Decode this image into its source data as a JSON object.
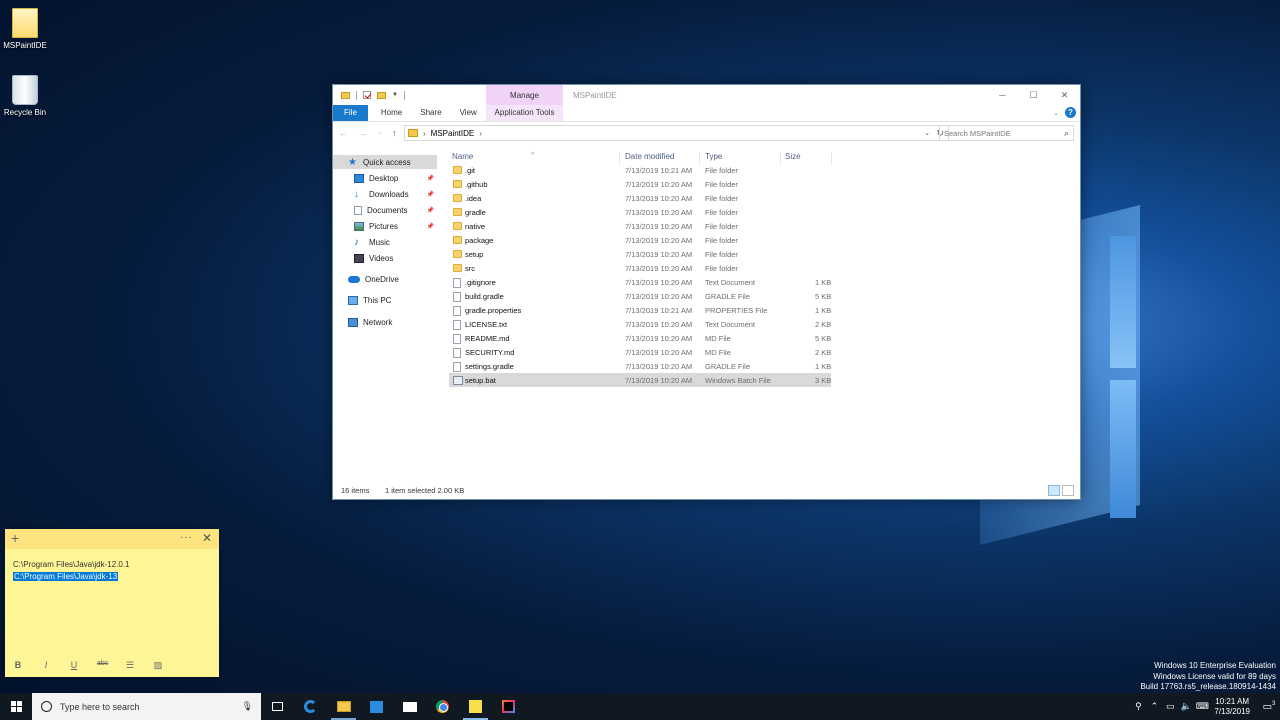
{
  "desktop": {
    "icons": [
      {
        "label": "MSPaintIDE",
        "icon": "folder-icon"
      },
      {
        "label": "Recycle Bin",
        "icon": "recycle-bin-icon"
      }
    ],
    "watermark": [
      "Windows 10 Enterprise Evaluation",
      "Windows License valid for 89 days",
      "Build 17763.rs5_release.180914-1434"
    ]
  },
  "explorer": {
    "title": "MSPaintIDE",
    "manage_tab": "Manage",
    "ribbon_tabs": {
      "file": "File",
      "home": "Home",
      "share": "Share",
      "view": "View",
      "app_tools": "Application Tools"
    },
    "address": {
      "path": "MSPaintIDE",
      "search_placeholder": "Search MSPaintIDE"
    },
    "nav_pane": {
      "quick_access": "Quick access",
      "items": [
        "Desktop",
        "Downloads",
        "Documents",
        "Pictures",
        "Music",
        "Videos"
      ],
      "onedrive": "OneDrive",
      "this_pc": "This PC",
      "network": "Network"
    },
    "columns": {
      "name": "Name",
      "date": "Date modified",
      "type": "Type",
      "size": "Size"
    },
    "files": [
      {
        "name": ".git",
        "date": "7/13/2019 10:21 AM",
        "type": "File folder",
        "size": "",
        "kind": "folder"
      },
      {
        "name": ".github",
        "date": "7/13/2019 10:20 AM",
        "type": "File folder",
        "size": "",
        "kind": "folder"
      },
      {
        "name": ".idea",
        "date": "7/13/2019 10:20 AM",
        "type": "File folder",
        "size": "",
        "kind": "folder"
      },
      {
        "name": "gradle",
        "date": "7/13/2019 10:20 AM",
        "type": "File folder",
        "size": "",
        "kind": "folder"
      },
      {
        "name": "native",
        "date": "7/13/2019 10:20 AM",
        "type": "File folder",
        "size": "",
        "kind": "folder"
      },
      {
        "name": "package",
        "date": "7/13/2019 10:20 AM",
        "type": "File folder",
        "size": "",
        "kind": "folder"
      },
      {
        "name": "setup",
        "date": "7/13/2019 10:20 AM",
        "type": "File folder",
        "size": "",
        "kind": "folder"
      },
      {
        "name": "src",
        "date": "7/13/2019 10:20 AM",
        "type": "File folder",
        "size": "",
        "kind": "folder"
      },
      {
        "name": ".gitignore",
        "date": "7/13/2019 10:20 AM",
        "type": "Text Document",
        "size": "1 KB",
        "kind": "file"
      },
      {
        "name": "build.gradle",
        "date": "7/13/2019 10:20 AM",
        "type": "GRADLE File",
        "size": "5 KB",
        "kind": "file"
      },
      {
        "name": "gradle.properties",
        "date": "7/13/2019 10:21 AM",
        "type": "PROPERTIES File",
        "size": "1 KB",
        "kind": "file"
      },
      {
        "name": "LICENSE.txt",
        "date": "7/13/2019 10:20 AM",
        "type": "Text Document",
        "size": "2 KB",
        "kind": "file"
      },
      {
        "name": "README.md",
        "date": "7/13/2019 10:20 AM",
        "type": "MD File",
        "size": "5 KB",
        "kind": "file"
      },
      {
        "name": "SECURITY.md",
        "date": "7/13/2019 10:20 AM",
        "type": "MD File",
        "size": "2 KB",
        "kind": "file"
      },
      {
        "name": "settings.gradle",
        "date": "7/13/2019 10:20 AM",
        "type": "GRADLE File",
        "size": "1 KB",
        "kind": "file"
      },
      {
        "name": "setup.bat",
        "date": "7/13/2019 10:20 AM",
        "type": "Windows Batch File",
        "size": "3 KB",
        "kind": "bat",
        "selected": true
      }
    ],
    "status": {
      "count": "16 items",
      "selection": "1 item selected  2.00 KB"
    }
  },
  "sticky_note": {
    "lines": [
      "C:\\Program Files\\Java\\jdk-12.0.1",
      "C:\\Program Files\\Java\\jdk-13"
    ],
    "tools": [
      "B",
      "I",
      "U",
      "abc"
    ]
  },
  "taskbar": {
    "search_placeholder": "Type here to search",
    "time": "10:21 AM",
    "date": "7/13/2019",
    "notification_count": "3"
  }
}
